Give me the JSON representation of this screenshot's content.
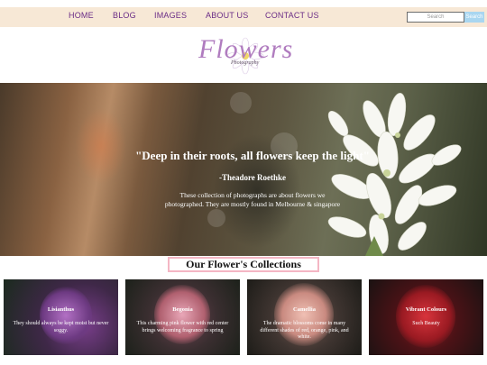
{
  "nav": {
    "items": [
      {
        "label": "HOME"
      },
      {
        "label": "BLOG"
      },
      {
        "label": "IMAGES"
      },
      {
        "label": "ABOUT US"
      },
      {
        "label": "CONTACT US"
      }
    ],
    "search_placeholder": "Search",
    "search_button": "Search"
  },
  "logo": {
    "title": "Flowers",
    "subtitle": "Photography"
  },
  "hero": {
    "quote": "\"Deep in their roots, all flowers keep the light\"",
    "author": "-Theadore Roethke",
    "description": "These collection of photographs are about flowers we photographed. They are mostly found in Melbourne & singapore"
  },
  "collections": {
    "title": "Our Flower's Collections",
    "cards": [
      {
        "title": "Lisianthus",
        "description": "They should always be kept moist but never soggy."
      },
      {
        "title": "Begonia",
        "description": "This charming pink flower with red center brings welcoming fragrance to spring"
      },
      {
        "title": "Camellia",
        "description": "The dramatic blossoms come in many different shades of red, orange, pink, and white."
      },
      {
        "title": "Vibrant Colours",
        "description": "Such Beauty"
      }
    ]
  },
  "colors": {
    "nav_background": "#f7e8d6",
    "nav_text": "#6a2c86",
    "search_button": "#a9d6f0",
    "title_border": "#f4b6c4",
    "logo": "#b07cbf"
  }
}
